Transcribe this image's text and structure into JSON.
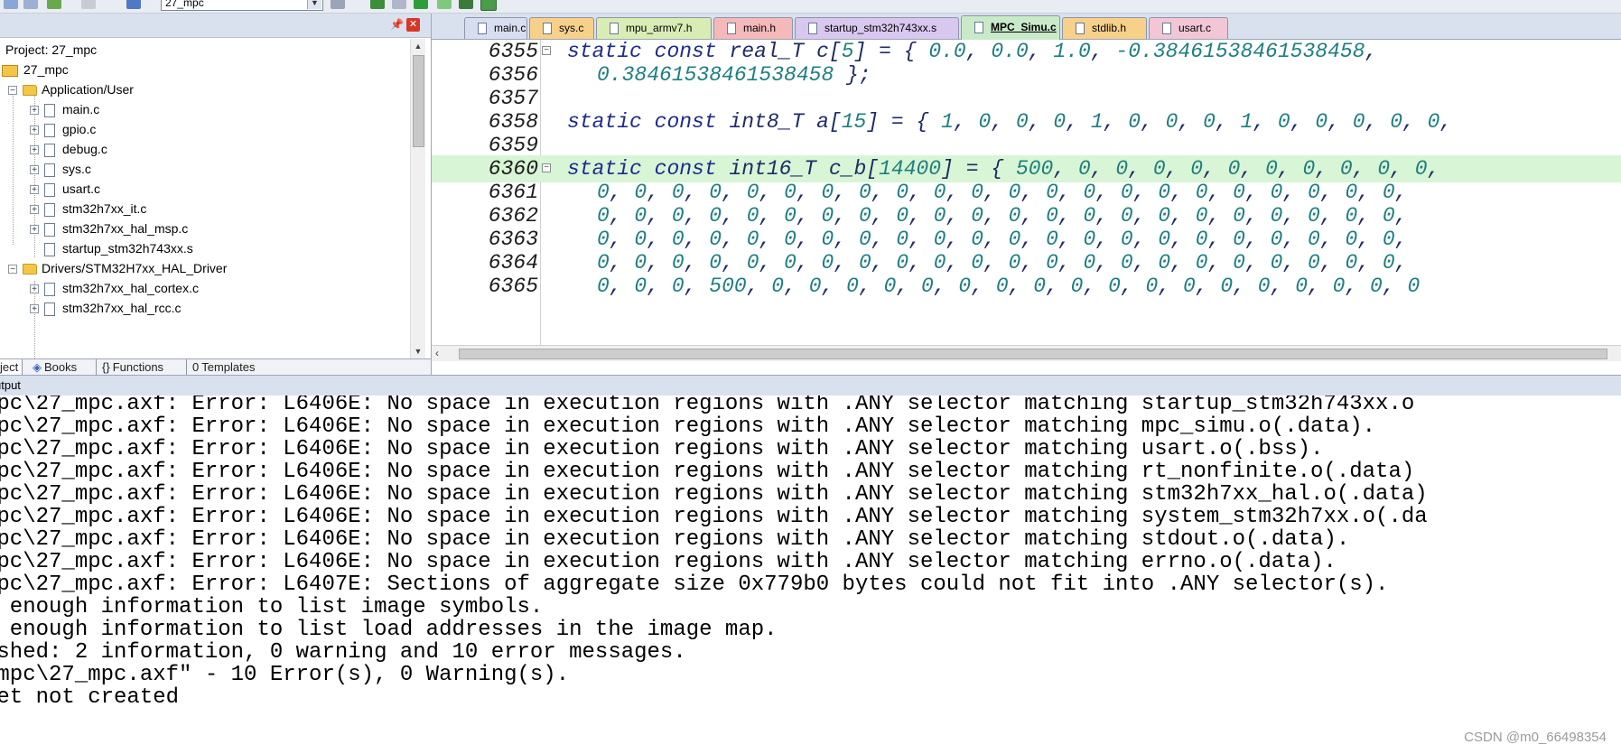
{
  "toolbar": {
    "target_combo_value": "27_mpc"
  },
  "project_panel": {
    "title_row": "Project: 27_mpc",
    "root": "27_mpc",
    "groups": [
      {
        "label": "Application/User",
        "files": [
          "main.c",
          "gpio.c",
          "debug.c",
          "sys.c",
          "usart.c",
          "stm32h7xx_it.c",
          "stm32h7xx_hal_msp.c",
          "startup_stm32h743xx.s"
        ]
      },
      {
        "label": "Drivers/STM32H7xx_HAL_Driver",
        "files": [
          "stm32h7xx_hal_cortex.c",
          "stm32h7xx_hal_rcc.c"
        ]
      }
    ],
    "tabs": [
      "ject",
      "Books",
      "Functions",
      "Templates"
    ]
  },
  "editor_tabs": [
    {
      "label": "main.c",
      "color": "#d8def0"
    },
    {
      "label": "sys.c",
      "color": "#f7d08a"
    },
    {
      "label": "mpu_armv7.h",
      "color": "#d8ecb4"
    },
    {
      "label": "main.h",
      "color": "#f5b9b9"
    },
    {
      "label": "startup_stm32h743xx.s",
      "color": "#d8c7ef"
    },
    {
      "label": "MPC_Simu.c",
      "color": "#c9eac8",
      "active": true
    },
    {
      "label": "stdlib.h",
      "color": "#f7d08a"
    },
    {
      "label": "usart.c",
      "color": "#f3c6d6"
    }
  ],
  "editor": {
    "lines": [
      {
        "no": "6355",
        "fold": "−",
        "text": "static const real_T c[5] = { 0.0, 0.0, 1.0, -0.38461538461538458,"
      },
      {
        "no": "6356",
        "fold": "",
        "text": "0.38461538461538458 };"
      },
      {
        "no": "6357",
        "fold": "",
        "text": ""
      },
      {
        "no": "6358",
        "fold": "",
        "text": "static const int8_T a[15] = { 1, 0, 0, 0, 1, 0, 0, 0, 1, 0, 0, 0, 0, 0,"
      },
      {
        "no": "6359",
        "fold": "",
        "text": ""
      },
      {
        "no": "6360",
        "fold": "−",
        "text": "static const int16_T c_b[14400] = { 500, 0, 0, 0, 0, 0, 0, 0, 0, 0, 0,",
        "highlight": true
      },
      {
        "no": "6361",
        "fold": "",
        "text": "0, 0, 0, 0, 0, 0, 0, 0, 0, 0, 0, 0, 0, 0, 0, 0, 0, 0, 0, 0, 0, 0,"
      },
      {
        "no": "6362",
        "fold": "",
        "text": "0, 0, 0, 0, 0, 0, 0, 0, 0, 0, 0, 0, 0, 0, 0, 0, 0, 0, 0, 0, 0, 0,"
      },
      {
        "no": "6363",
        "fold": "",
        "text": "0, 0, 0, 0, 0, 0, 0, 0, 0, 0, 0, 0, 0, 0, 0, 0, 0, 0, 0, 0, 0, 0,"
      },
      {
        "no": "6364",
        "fold": "",
        "text": "0, 0, 0, 0, 0, 0, 0, 0, 0, 0, 0, 0, 0, 0, 0, 0, 0, 0, 0, 0, 0, 0,"
      },
      {
        "no": "6365",
        "fold": "",
        "text": "0, 0, 0, 500, 0, 0, 0, 0, 0, 0, 0, 0, 0, 0, 0, 0, 0, 0, 0, 0, 0, 0"
      }
    ]
  },
  "output": {
    "title": "utput",
    "lines": [
      "mpc\\27_mpc.axf: Error: L6406E: No space in execution regions with .ANY selector matching startup_stm32h743xx.o",
      "mpc\\27_mpc.axf: Error: L6406E: No space in execution regions with .ANY selector matching mpc_simu.o(.data).",
      "mpc\\27_mpc.axf: Error: L6406E: No space in execution regions with .ANY selector matching usart.o(.bss).",
      "mpc\\27_mpc.axf: Error: L6406E: No space in execution regions with .ANY selector matching rt_nonfinite.o(.data)",
      "mpc\\27_mpc.axf: Error: L6406E: No space in execution regions with .ANY selector matching stm32h7xx_hal.o(.data)",
      "mpc\\27_mpc.axf: Error: L6406E: No space in execution regions with .ANY selector matching system_stm32h7xx.o(.da",
      "mpc\\27_mpc.axf: Error: L6406E: No space in execution regions with .ANY selector matching stdout.o(.data).",
      "mpc\\27_mpc.axf: Error: L6406E: No space in execution regions with .ANY selector matching errno.o(.data).",
      "mpc\\27_mpc.axf: Error: L6407E: Sections of aggregate size 0x779b0 bytes could not fit into .ANY selector(s).",
      "  enough information to list image symbols.",
      "  enough information to list load addresses in the image map.",
      "ished: 2 information, 0 warning and 10 error messages.",
      "_mpc\\27_mpc.axf\" - 10 Error(s), 0 Warning(s).",
      "get not created"
    ]
  },
  "watermark": "CSDN @m0_66498354"
}
